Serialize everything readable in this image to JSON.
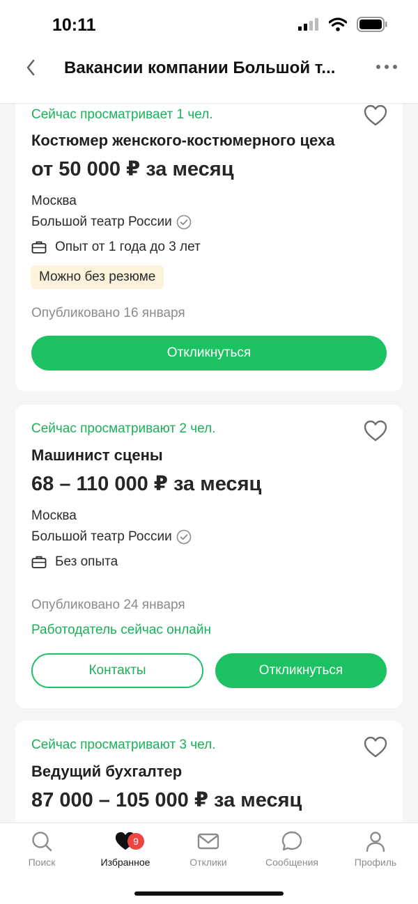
{
  "status_bar": {
    "time": "10:11"
  },
  "header": {
    "title": "Вакансии компании Большой т..."
  },
  "vacancies": [
    {
      "viewers": "Сейчас просматривает 1 чел.",
      "title": "Костюмер женского-костюмерного цеха",
      "salary": "от 50 000 ₽ за месяц",
      "city": "Москва",
      "company": "Большой театр России",
      "experience": "Опыт от 1 года до 3 лет",
      "tag": "Можно без резюме",
      "published": "Опубликовано 16 января",
      "respond_label": "Откликнуться"
    },
    {
      "viewers": "Сейчас просматривают 2 чел.",
      "title": "Машинист сцены",
      "salary": "68 – 110 000 ₽ за месяц",
      "city": "Москва",
      "company": "Большой театр России",
      "experience": "Без опыта",
      "published": "Опубликовано 24 января",
      "online": "Работодатель сейчас онлайн",
      "contacts_label": "Контакты",
      "respond_label": "Откликнуться"
    },
    {
      "viewers": "Сейчас просматривают 3 чел.",
      "title": "Ведущий бухгалтер",
      "salary": "87 000 – 105 000 ₽ за месяц"
    }
  ],
  "bottom_nav": {
    "items": [
      {
        "label": "Поиск",
        "icon": "search-icon"
      },
      {
        "label": "Избранное",
        "icon": "heart-icon",
        "badge": "9",
        "active": true
      },
      {
        "label": "Отклики",
        "icon": "mail-icon"
      },
      {
        "label": "Сообщения",
        "icon": "chat-icon"
      },
      {
        "label": "Профиль",
        "icon": "profile-icon"
      }
    ]
  },
  "colors": {
    "accent": "#1cc162",
    "accent_text": "#1bb05a",
    "tag_bg": "#fdf3dc",
    "badge": "#f04343"
  }
}
